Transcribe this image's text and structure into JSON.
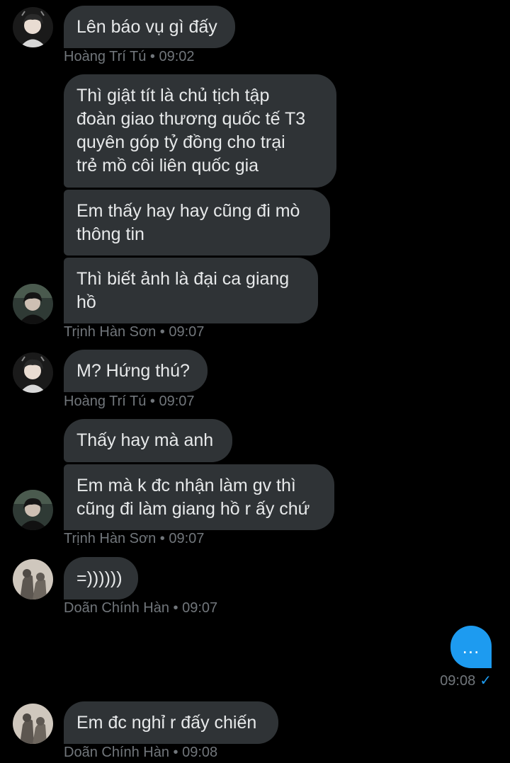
{
  "colors": {
    "background": "#000000",
    "bubble_in": "#2f3336",
    "bubble_out": "#1d9bf0",
    "text": "#e7e9ea",
    "meta": "#71767b"
  },
  "messages": [
    {
      "bubbles": [
        "Lên báo vụ gì đấy"
      ],
      "sender": "Hoàng Trí Tú",
      "time": "09:02"
    },
    {
      "bubbles": [
        "Thì giật tít là chủ tịch tập\nđoàn giao thương quốc tế T3\nquyên góp tỷ đồng cho trại\ntrẻ mồ côi liên quốc gia",
        "Em thấy hay hay cũng đi mò\nthông tin",
        "Thì biết ảnh là đại ca giang\nhồ"
      ],
      "sender": "Trịnh Hàn Sơn",
      "time": "09:07"
    },
    {
      "bubbles": [
        "M? Hứng thú?"
      ],
      "sender": "Hoàng Trí Tú",
      "time": "09:07"
    },
    {
      "bubbles": [
        "Thấy hay mà anh",
        "Em mà k đc nhận làm gv thì\ncũng đi làm giang hồ r ấy chứ"
      ],
      "sender": "Trịnh Hàn Sơn",
      "time": "09:07"
    },
    {
      "bubbles": [
        "=))))))"
      ],
      "sender": "Doãn Chính Hàn",
      "time": "09:07"
    },
    {
      "bubbles": [
        "Em đc nghỉ r đấy chiến"
      ],
      "sender": "Doãn Chính Hàn",
      "time": "09:08"
    }
  ],
  "my_message": {
    "text": "...",
    "time": "09:08",
    "status_icon": "check-icon"
  },
  "separator": " • "
}
